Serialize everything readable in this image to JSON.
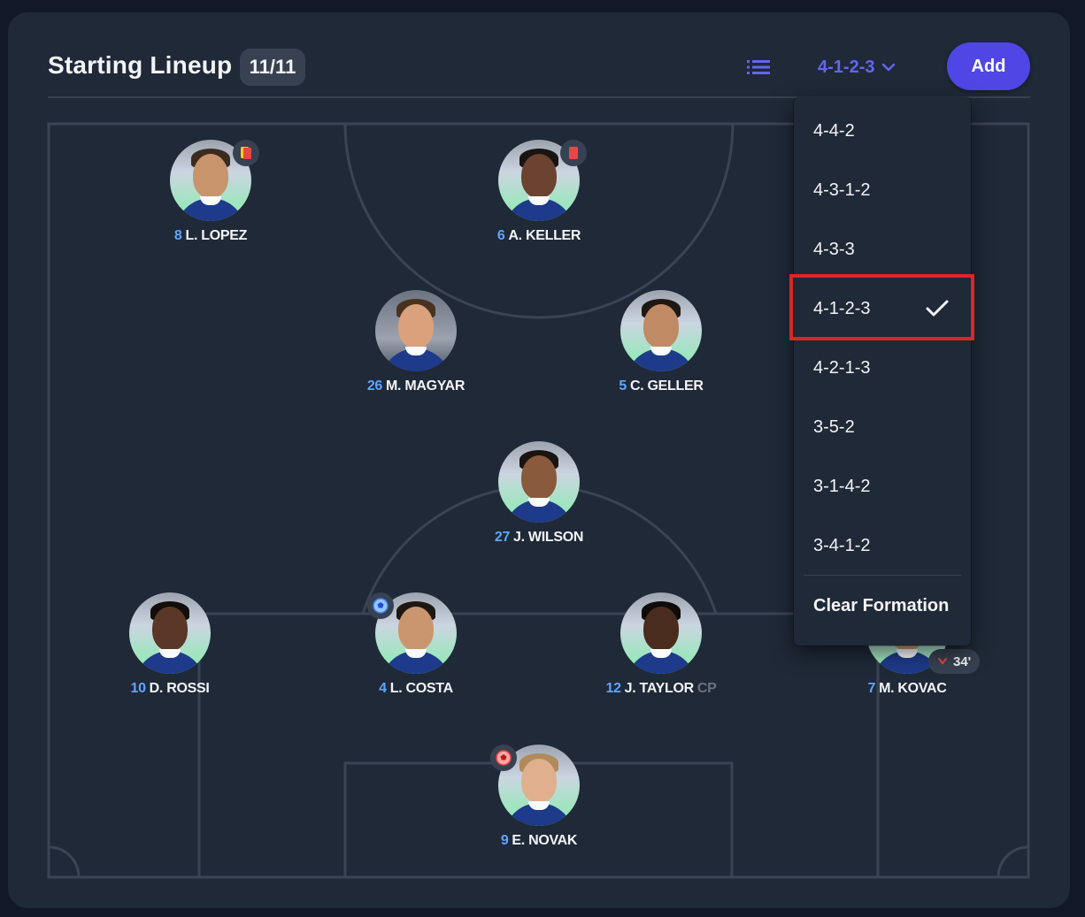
{
  "header": {
    "title": "Starting Lineup",
    "count": "11/11",
    "formation": "4-1-2-3",
    "add_label": "Add"
  },
  "colors": {
    "background": "#111827",
    "card": "#1f2937",
    "accent": "#4f46e5",
    "number": "#60a5fa",
    "highlight": "#dc2626"
  },
  "players": [
    {
      "number": "8",
      "name": "L. LOPEZ",
      "tag": "",
      "card": "yellow-red"
    },
    {
      "number": "6",
      "name": "A. KELLER",
      "tag": "",
      "card": "red"
    },
    {
      "number": "26",
      "name": "M. MAGYAR",
      "tag": ""
    },
    {
      "number": "5",
      "name": "C. GELLER",
      "tag": ""
    },
    {
      "number": "27",
      "name": "J. WILSON",
      "tag": ""
    },
    {
      "number": "10",
      "name": "D. ROSSI",
      "tag": ""
    },
    {
      "number": "4",
      "name": "L. COSTA",
      "tag": "",
      "event": "goal"
    },
    {
      "number": "12",
      "name": "J. TAYLOR",
      "tag": "CP"
    },
    {
      "number": "7",
      "name": "M. KOVAC",
      "tag": "",
      "sub_minute": "34'"
    },
    {
      "number": "9",
      "name": "E. NOVAK",
      "tag": "",
      "event": "own-goal"
    }
  ],
  "dropdown": {
    "options": [
      "4-4-2",
      "4-3-1-2",
      "4-3-3",
      "4-1-2-3",
      "4-2-1-3",
      "3-5-2",
      "3-1-4-2",
      "3-4-1-2"
    ],
    "selected": "4-1-2-3",
    "clear_label": "Clear Formation"
  },
  "icons": {
    "view_toggle": "list-icon",
    "formation_toggle": "chevron-down-icon",
    "selected_marker": "check-icon"
  }
}
